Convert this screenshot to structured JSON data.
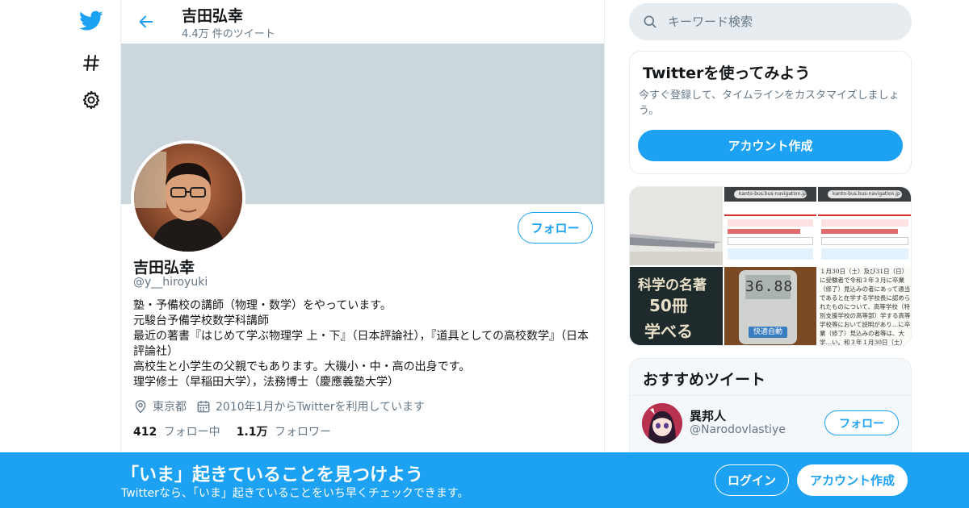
{
  "nav": {
    "icons": [
      "twitter-bird-icon",
      "hashtag-icon",
      "gear-icon"
    ]
  },
  "header": {
    "name": "吉田弘幸",
    "tweet_count": "4.4万 件のツイート"
  },
  "profile": {
    "name": "吉田弘幸",
    "handle": "@y__hiroyuki",
    "follow_label": "フォロー",
    "bio": "塾・予備校の講師（物理・数学）をやっています。\n元駿台予備学校数学科講師\n最近の著書『はじめて学ぶ物理学 上・下』（日本評論社），『道具としての高校数学』（日本評論社）\n高校生と小学生の父親でもあります。大磯小・中・高の出身です。\n理学修士（早稲田大学），法務博士（慶應義塾大学）",
    "location": "東京都",
    "joined": "2010年1月からTwitterを利用しています",
    "following_count": "412",
    "following_label": "フォロー中",
    "followers_count": "1.1万",
    "followers_label": "フォロワー"
  },
  "search": {
    "placeholder": "キーワード検索"
  },
  "signup_card": {
    "title": "Twitterを使ってみよう",
    "text": "今すぐ登録して、タイムラインをカスタマイズしましょう。",
    "button": "アカウント作成"
  },
  "media": {
    "tiles": [
      {
        "name": "laptop-photo"
      },
      {
        "name": "bus-navigation-screenshot-1",
        "url_text": "kanto-bus.bus-navigation.jp"
      },
      {
        "name": "bus-navigation-screenshot-2",
        "url_text": "kanto-bus.bus-navigation.jp"
      },
      {
        "name": "book-cover-photo",
        "line1": "科学の名著",
        "line2": "50冊",
        "line3": "学べる"
      },
      {
        "name": "thermometer-photo",
        "reading": "36.88",
        "button_text": "快適自動"
      },
      {
        "name": "document-photo",
        "text": "１月30日（土）及び31日（日）に受験者で令和３年３月に卒業（修了）見込みの者にあって通当であると在学する学校長に認められたものについて、高等学校（特別支援学校の高等部）学する高等学校等において説明があり…に卒業（修了）見込みの者等は、大学…い。和３年１月30日（土）及び31日（日）"
      }
    ]
  },
  "recommend": {
    "title": "おすすめツイート",
    "name": "異邦人",
    "handle": "@Narodovlastiye",
    "follow_label": "フォロー"
  },
  "bottom_bar": {
    "title": "「いま」起きていることを見つけよう",
    "subtitle": "Twitterなら、「いま」起きていることをいち早くチェックできます。",
    "login": "ログイン",
    "signup": "アカウント作成"
  },
  "colors": {
    "accent": "#1da1f2",
    "banner": "#ccd6dd",
    "secondary_text": "#657786"
  }
}
